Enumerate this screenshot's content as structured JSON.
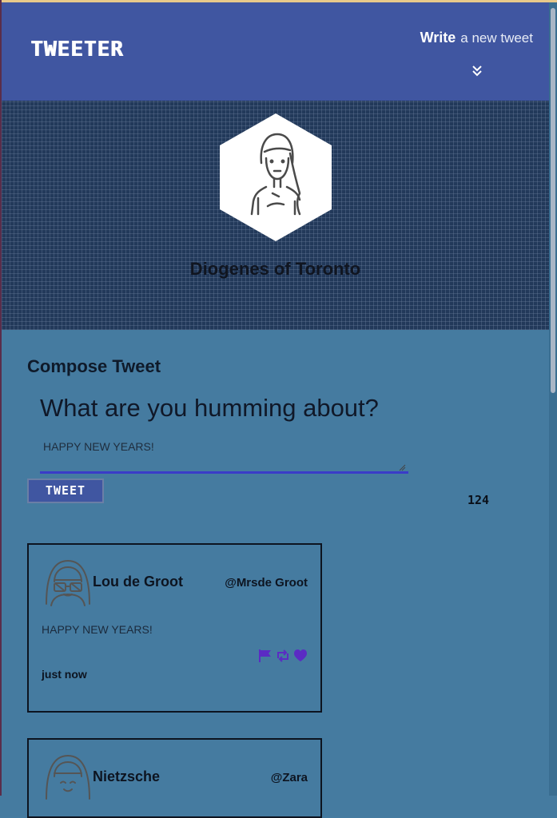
{
  "nav": {
    "brand": "TWEETER",
    "write_bold": "Write",
    "write_rest": "a new tweet",
    "chevron_icon": "double-chevron-down-icon"
  },
  "profile": {
    "name": "Diogenes of Toronto",
    "avatar_icon": "user-avatar-icon"
  },
  "compose": {
    "title": "Compose Tweet",
    "prompt": "What are you humming about?",
    "text": "HAPPY NEW YEARS!",
    "button_label": "TWEET",
    "char_counter": "124"
  },
  "tweets": [
    {
      "name": "Lou de Groot",
      "handle": "@Mrsde Groot",
      "text": "HAPPY NEW YEARS!",
      "time": "just now",
      "icons": [
        "flag-icon",
        "retweet-icon",
        "heart-icon"
      ]
    },
    {
      "name": "Nietzsche",
      "handle": "@Zara"
    }
  ],
  "colors": {
    "nav_bg": "#4056a1",
    "page_bg": "#457ba0",
    "accent": "#5b2bc4"
  }
}
